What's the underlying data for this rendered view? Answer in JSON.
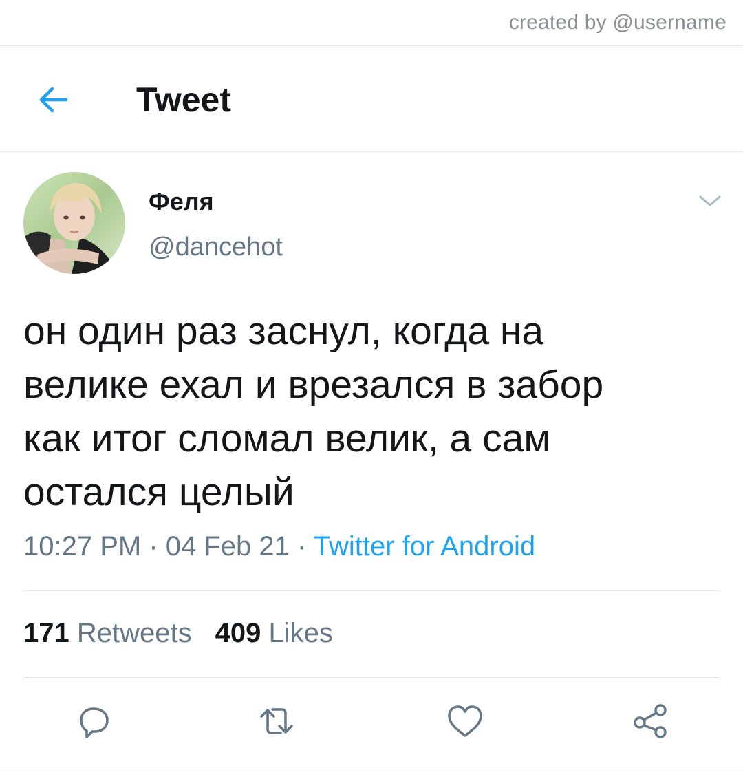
{
  "credit": "created by @username",
  "header": {
    "title": "Tweet",
    "back_icon": "arrow-left-icon"
  },
  "author": {
    "display_name": "Феля",
    "handle": "@dancehot"
  },
  "tweet": {
    "text": "он один раз заснул, когда на\nвелике ехал и врезался в забор\nкак итог сломал велик, а сам\nостался целый",
    "time": "10:27 PM",
    "separator": " · ",
    "date": "04 Feb 21",
    "source": "Twitter for Android"
  },
  "stats": {
    "retweets_count": "171",
    "retweets_label": "Retweets",
    "likes_count": "409",
    "likes_label": "Likes"
  },
  "actions": [
    {
      "icon": "reply-icon"
    },
    {
      "icon": "retweet-icon"
    },
    {
      "icon": "heart-icon"
    },
    {
      "icon": "share-icon"
    }
  ],
  "colors": {
    "accent": "#1da1f2",
    "secondary_text": "#657786",
    "divider": "#e1e8ed",
    "icon": "#657786"
  }
}
